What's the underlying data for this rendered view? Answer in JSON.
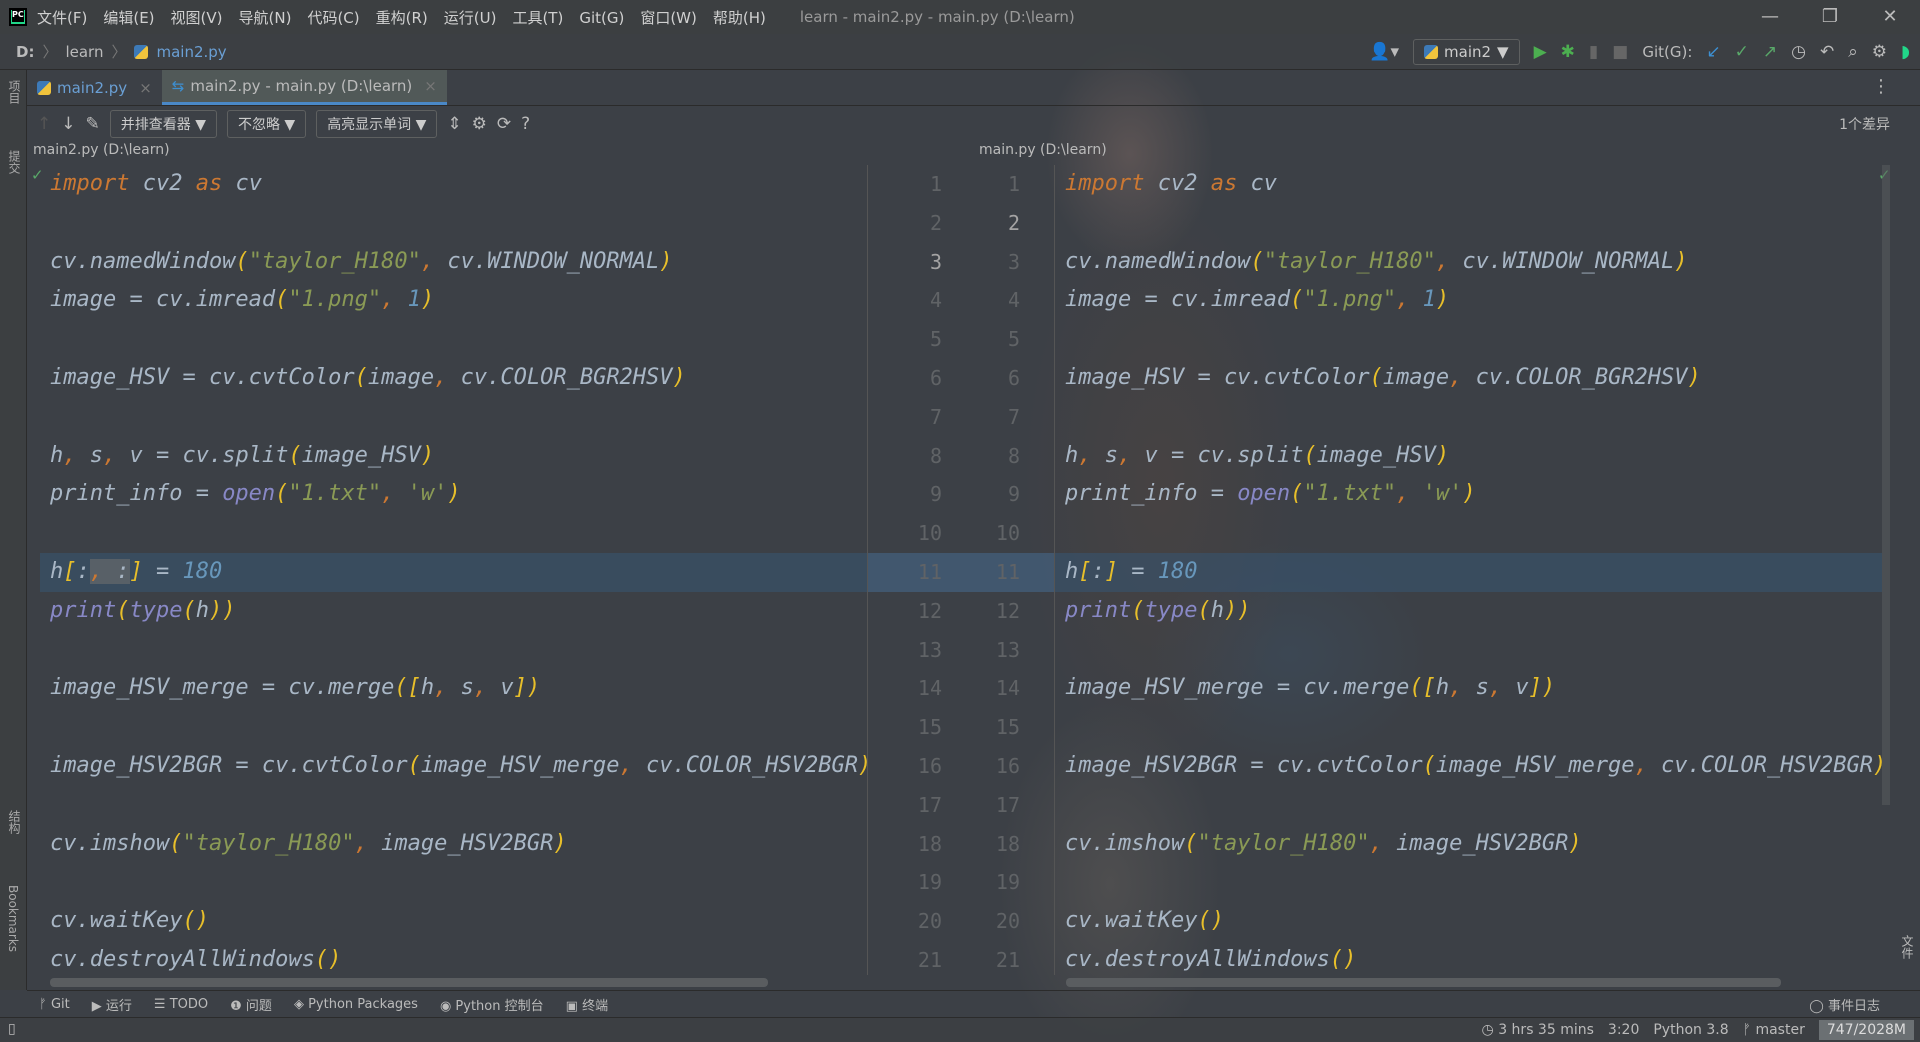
{
  "titlebar": {
    "menu": [
      "文件(F)",
      "编辑(E)",
      "视图(V)",
      "导航(N)",
      "代码(C)",
      "重构(R)",
      "运行(U)",
      "工具(T)",
      "Git(G)",
      "窗口(W)",
      "帮助(H)"
    ],
    "title": "learn - main2.py - main.py (D:\\learn)",
    "minimize": "—",
    "restore": "❐",
    "close": "✕"
  },
  "breadcrumb": {
    "drive": "D:",
    "folder": "learn",
    "file": "main2.py"
  },
  "navbar": {
    "run_config": "main2",
    "git_label": "Git(G):"
  },
  "sidebar": {
    "project": "项目",
    "commit": "提交",
    "structure": "结构",
    "bookmarks": "Bookmarks",
    "files": "文件"
  },
  "tabs": [
    {
      "label": "main2.py"
    },
    {
      "label": "main2.py - main.py (D:\\learn)"
    }
  ],
  "diff_toolbar": {
    "viewer": "并排查看器",
    "ignore": "不忽略",
    "highlight": "高亮显示单词",
    "help": "?",
    "diff_count": "1个差异"
  },
  "left_pane": {
    "path": "main2.py (D:\\learn)",
    "lines": [
      "import cv2 as cv",
      "",
      "cv.namedWindow(\"taylor_H180\", cv.WINDOW_NORMAL)",
      "image = cv.imread(\"1.png\", 1)",
      "",
      "image_HSV = cv.cvtColor(image, cv.COLOR_BGR2HSV)",
      "",
      "h, s, v = cv.split(image_HSV)",
      "print_info = open(\"1.txt\", 'w')",
      "",
      "h[:, :] = 180",
      "print(type(h))",
      "",
      "image_HSV_merge = cv.merge([h, s, v])",
      "",
      "image_HSV2BGR = cv.cvtColor(image_HSV_merge, cv.COLOR_HSV2BGR)",
      "",
      "cv.imshow(\"taylor_H180\", image_HSV2BGR)",
      "",
      "cv.waitKey()",
      "cv.destroyAllWindows()"
    ]
  },
  "right_pane": {
    "path": "main.py (D:\\learn)",
    "lines": [
      "import cv2 as cv",
      "",
      "cv.namedWindow(\"taylor_H180\", cv.WINDOW_NORMAL)",
      "image = cv.imread(\"1.png\", 1)",
      "",
      "image_HSV = cv.cvtColor(image, cv.COLOR_BGR2HSV)",
      "",
      "h, s, v = cv.split(image_HSV)",
      "print_info = open(\"1.txt\", 'w')",
      "",
      "h[:] = 180",
      "print(type(h))",
      "",
      "image_HSV_merge = cv.merge([h, s, v])",
      "",
      "image_HSV2BGR = cv.cvtColor(image_HSV_merge, cv.COLOR_HSV2BGR)",
      "",
      "cv.imshow(\"taylor_H180\", image_HSV2BGR)",
      "",
      "cv.waitKey()",
      "cv.destroyAllWindows()"
    ]
  },
  "changed_line": 11,
  "toolwindows": [
    "Git",
    "运行",
    "TODO",
    "问题",
    "Python Packages",
    "Python 控制台",
    "终端"
  ],
  "event_log": "事件日志",
  "status": {
    "time": "3 hrs 35 mins",
    "position": "3:20",
    "interpreter": "Python 3.8",
    "branch": "master",
    "memory": "747/2028M"
  },
  "colors": {
    "keyword": "#cc7832",
    "string": "#8a9a55",
    "number": "#6897bb",
    "builtin": "#8888c6",
    "accent": "#4a88c7"
  }
}
